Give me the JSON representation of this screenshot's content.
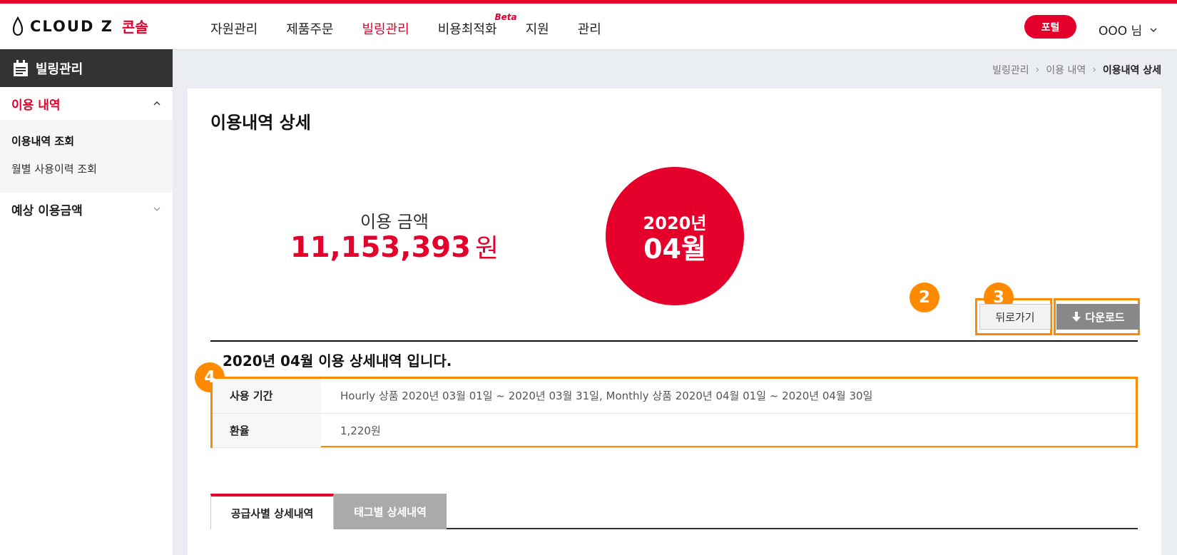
{
  "header": {
    "logo_text": "CLOUD Z",
    "brand": "콘솔",
    "nav": [
      {
        "label": "자원관리"
      },
      {
        "label": "제품주문"
      },
      {
        "label": "빌링관리"
      },
      {
        "label": "비용최적화",
        "badge": "Beta"
      },
      {
        "label": "지원"
      },
      {
        "label": "관리"
      }
    ],
    "active_nav": "빌링관리",
    "portal_label": "포털",
    "user_label": "OOO 님"
  },
  "sidebar": {
    "title": "빌링관리",
    "groups": [
      {
        "label": "이용 내역",
        "expanded": true,
        "items": [
          {
            "label": "이용내역 조회",
            "active": true
          },
          {
            "label": "월별 사용이력 조회",
            "active": false
          }
        ]
      },
      {
        "label": "예상 이용금액",
        "expanded": false
      }
    ]
  },
  "breadcrumb": [
    "빌링관리",
    "이용 내역",
    "이용내역 상세"
  ],
  "main": {
    "page_title": "이용내역 상세",
    "amount_label": "이용 금액",
    "amount_value": "11,153,393",
    "amount_unit": "원",
    "period_year": "2020년",
    "period_month": "04월",
    "back_label": "뒤로가기",
    "download_label": "다운로드",
    "section_title": "2020년 04월 이용 상세내역 입니다.",
    "info_rows": [
      {
        "label": "사용 기간",
        "value": "Hourly 상품 2020년 03월 01일 ~ 2020년 03월 31일, Monthly 상품 2020년 04월 01일 ~ 2020년 04월 30일"
      },
      {
        "label": "환율",
        "value": "1,220원"
      }
    ],
    "tabs": [
      {
        "label": "공급사별 상세내역",
        "active": true
      },
      {
        "label": "태그별 상세내역",
        "active": false
      }
    ]
  },
  "annotations": [
    "2",
    "3",
    "4"
  ],
  "colors": {
    "brand_red": "#e4002b",
    "highlight_orange": "#ff8a00",
    "sidebar_header": "#333333"
  },
  "icons": [
    "logo-drop-icon",
    "chevron-down-icon",
    "calendar-icon",
    "chevron-up-icon",
    "download-arrow-icon",
    "breadcrumb-separator-icon"
  ]
}
